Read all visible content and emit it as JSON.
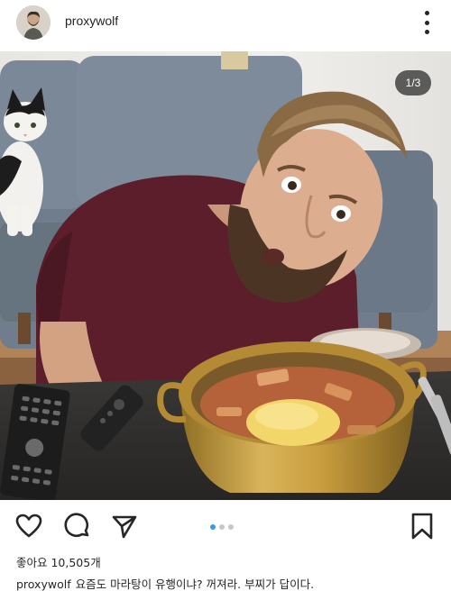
{
  "post": {
    "username": "proxywolf",
    "image_counter": "1/3",
    "likes_text": "좋아요 10,505개",
    "caption_user": "proxywolf",
    "caption_text": "요즘도 마라탕이 유행이냐? 꺼져라. 부찌가 답이다.",
    "carousel_dots": 3,
    "carousel_active": 1
  },
  "icons": {
    "more": "more-vertical-icon",
    "like": "heart-icon",
    "comment": "comment-icon",
    "share": "send-icon",
    "save": "bookmark-icon"
  },
  "colors": {
    "text": "#262626",
    "active_dot": "#3897f0",
    "inactive_dot": "#c7c7c7"
  }
}
